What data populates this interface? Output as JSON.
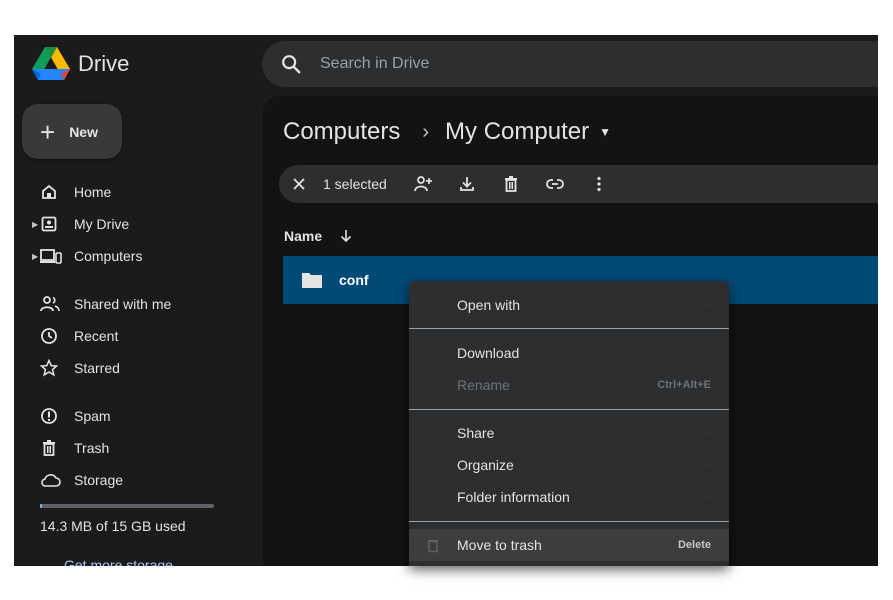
{
  "app": {
    "brand": "Drive"
  },
  "search": {
    "placeholder": "Search in Drive"
  },
  "sidebar": {
    "new_label": "New",
    "items": [
      {
        "label": "Home"
      },
      {
        "label": "My Drive"
      },
      {
        "label": "Computers"
      },
      {
        "label": "Shared with me"
      },
      {
        "label": "Recent"
      },
      {
        "label": "Starred"
      },
      {
        "label": "Spam"
      },
      {
        "label": "Trash"
      },
      {
        "label": "Storage"
      }
    ],
    "storage_used": "14.3 MB of 15 GB used",
    "storage_fraction": 0.001,
    "storage_link": "Get more storage"
  },
  "breadcrumb": {
    "parent": "Computers",
    "separator": "›",
    "current": "My Computer"
  },
  "selection": {
    "count_label": "1 selected"
  },
  "list": {
    "column_name": "Name",
    "rows": [
      {
        "name": "conf",
        "type": "folder"
      }
    ]
  },
  "context_menu": {
    "items": [
      {
        "label": "Open with"
      },
      {
        "label": "Download"
      },
      {
        "label": "Rename",
        "shortcut": "Ctrl+Alt+E"
      },
      {
        "label": "Share"
      },
      {
        "label": "Organize"
      },
      {
        "label": "Folder information"
      },
      {
        "label": "Move to trash",
        "shortcut": "Delete"
      }
    ]
  },
  "colors": {
    "app_bg": "#1b1b1b",
    "main_bg": "#131314",
    "selected_row": "#004a77",
    "menu_bg": "#2d2e30",
    "text": "#e3e3e3",
    "link": "#a8c7fa"
  }
}
